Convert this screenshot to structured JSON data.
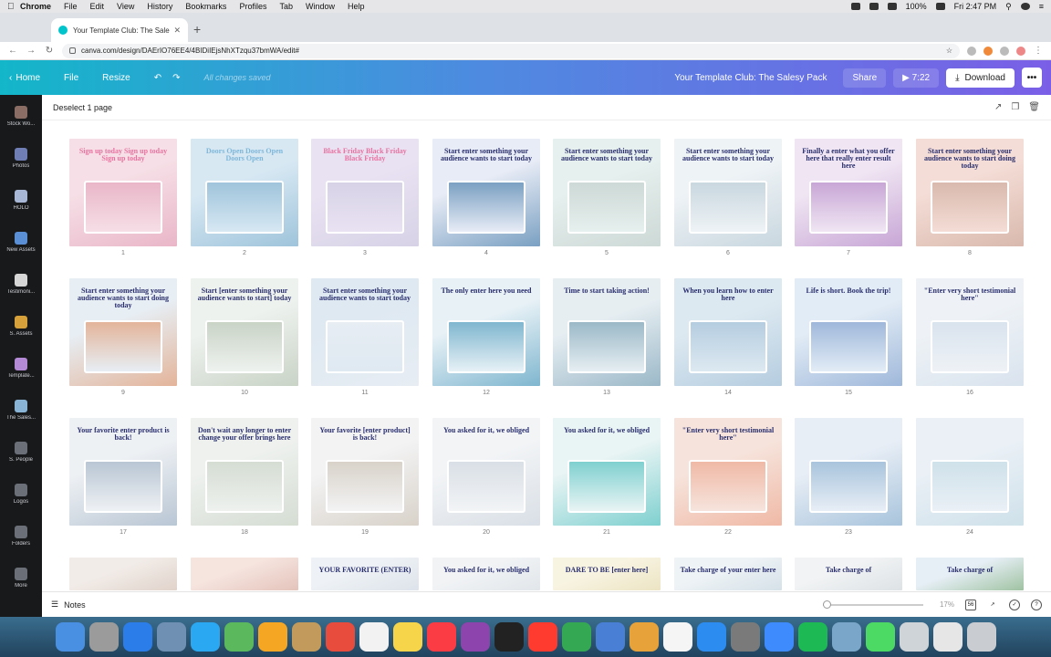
{
  "mac": {
    "app": "Chrome",
    "menus": [
      "File",
      "Edit",
      "View",
      "History",
      "Bookmarks",
      "Profiles",
      "Tab",
      "Window",
      "Help"
    ],
    "battery": "100%",
    "clock": "Fri 2:47 PM"
  },
  "browser": {
    "tab_title": "Your Template Club: The Sales",
    "url": "canva.com/design/DAErIO76EE4/4BIDiIEjsNhXTzqu37bmWA/edit#"
  },
  "canva": {
    "home": "Home",
    "file": "File",
    "resize": "Resize",
    "saved_status": "All changes saved",
    "design_title": "Your Template Club: The Salesy Pack",
    "share": "Share",
    "play_time": "7:22",
    "download": "Download",
    "more": "•••",
    "deselect": "Deselect 1 page",
    "notes": "Notes",
    "zoom": "17%",
    "grid_count": "56"
  },
  "sidebar": [
    {
      "label": "Stock Wo...",
      "color": "#8a6e66"
    },
    {
      "label": "Photos",
      "color": "#6f7fb5"
    },
    {
      "label": "HOLO",
      "color": "#a8b7d6"
    },
    {
      "label": "New Assets",
      "color": "#5a8fd6"
    },
    {
      "label": "Testimoni...",
      "color": "#d6d6d6"
    },
    {
      "label": "S. Assets",
      "color": "#d6a03a"
    },
    {
      "label": "Template...",
      "color": "#b48ad6"
    },
    {
      "label": "The Sales...",
      "color": "#8ab4d6"
    },
    {
      "label": "S. People",
      "color": "#6b6f78"
    },
    {
      "label": "Logos",
      "color": "#6b6f78"
    },
    {
      "label": "Folders",
      "color": "#6b6f78"
    },
    {
      "label": "More",
      "color": "#6b6f78"
    }
  ],
  "pages": [
    {
      "n": "1",
      "text": "Sign up today Sign up today Sign up today",
      "bg": "#f6dfe6",
      "bg2": "#e9b6c8",
      "ink": "#e873a0"
    },
    {
      "n": "2",
      "text": "Doors Open Doors Open Doors Open",
      "bg": "#d7e8f3",
      "bg2": "#9fc4db",
      "ink": "#7fb7d9"
    },
    {
      "n": "3",
      "text": "Black Friday Black Friday Black Friday",
      "bg": "#e9e2f3",
      "bg2": "#d7d2e6",
      "ink": "#e873a0"
    },
    {
      "n": "4",
      "text": "Start enter something your audience wants to start today",
      "bg": "#e8ecf6",
      "bg2": "#7aa0c2",
      "ink": "#2a2f6e"
    },
    {
      "n": "5",
      "text": "Start enter something your audience wants to start today",
      "bg": "#e6f0ee",
      "bg2": "#cdd9d6",
      "ink": "#2a2f6e"
    },
    {
      "n": "6",
      "text": "Start enter something your audience wants to start today",
      "bg": "#eef3f6",
      "bg2": "#c9d7df",
      "ink": "#2a2f6e"
    },
    {
      "n": "7",
      "text": "Finally a enter what you offer here that really enter result here",
      "bg": "#f0e6f3",
      "bg2": "#c8a6d6",
      "ink": "#2a2f6e"
    },
    {
      "n": "8",
      "text": "Start enter something your audience wants to start doing today",
      "bg": "#f4ddd6",
      "bg2": "#d9b9ad",
      "ink": "#2a2f6e"
    },
    {
      "n": "9",
      "text": "Start enter something your audience wants to start doing today",
      "bg": "#e7eef4",
      "bg2": "#e3b49a",
      "ink": "#2a2f6e"
    },
    {
      "n": "10",
      "text": "Start [enter something your audience wants to start] today",
      "bg": "#eef2ef",
      "bg2": "#c9d3c6",
      "ink": "#2a2f6e"
    },
    {
      "n": "11",
      "text": "Start enter something your audience wants to start today",
      "bg": "#dfe9f2",
      "bg2": "#e7edf3",
      "ink": "#2a2f6e"
    },
    {
      "n": "12",
      "text": "The only enter here you need",
      "bg": "#e7f1f6",
      "bg2": "#7fb6cf",
      "ink": "#2a2f6e"
    },
    {
      "n": "13",
      "text": "Time to start taking action!",
      "bg": "#e6eef2",
      "bg2": "#9bb8c8",
      "ink": "#2a2f6e"
    },
    {
      "n": "14",
      "text": "When you learn how to enter here",
      "bg": "#dde9f1",
      "bg2": "#b5cde0",
      "ink": "#2a2f6e"
    },
    {
      "n": "15",
      "text": "Life is short. Book the trip!",
      "bg": "#e2ecf6",
      "bg2": "#9fb8da",
      "ink": "#2a2f6e"
    },
    {
      "n": "16",
      "text": "\"Enter very short testimonial here\"",
      "bg": "#eef2f6",
      "bg2": "#d9e3ee",
      "ink": "#2a2f6e"
    },
    {
      "n": "17",
      "text": "Your favorite enter product is back!",
      "bg": "#eef1f4",
      "bg2": "#b9c6d4",
      "ink": "#2a2f6e"
    },
    {
      "n": "18",
      "text": "Don't wait any longer to enter change your offer brings here",
      "bg": "#eef1ee",
      "bg2": "#d5ddd3",
      "ink": "#2a2f6e"
    },
    {
      "n": "19",
      "text": "Your favorite [enter product] is back!",
      "bg": "#f3f3f4",
      "bg2": "#d8d2c9",
      "ink": "#2a2f6e"
    },
    {
      "n": "20",
      "text": "You asked for it, we obliged",
      "bg": "#f2f4f6",
      "bg2": "#d9dfe6",
      "ink": "#2a2f6e"
    },
    {
      "n": "21",
      "text": "You asked for it, we obliged",
      "bg": "#e9f4f4",
      "bg2": "#7fd0d0",
      "ink": "#2a2f6e"
    },
    {
      "n": "22",
      "text": "\"Enter very short testimonial here\"",
      "bg": "#f6e4dc",
      "bg2": "#f0b9a6",
      "ink": "#2a2f6e"
    },
    {
      "n": "23",
      "text": "",
      "bg": "#e8eef6",
      "bg2": "#a8c4dc",
      "ink": "#2a2f6e"
    },
    {
      "n": "24",
      "text": "",
      "bg": "#eaf0f6",
      "bg2": "#cfe1ea",
      "ink": "#2a2f6e"
    },
    {
      "n": "",
      "text": "",
      "bg": "#f2ece8",
      "bg2": "#e0d3cb",
      "ink": "#2a2f6e"
    },
    {
      "n": "",
      "text": "",
      "bg": "#f6e4df",
      "bg2": "#e4c4bb",
      "ink": "#2a2f6e"
    },
    {
      "n": "",
      "text": "YOUR FAVORITE (ENTER)",
      "bg": "#eef2f6",
      "bg2": "#dde3ea",
      "ink": "#2a2f6e"
    },
    {
      "n": "",
      "text": "You asked for it, we obliged",
      "bg": "#f1f3f5",
      "bg2": "#e1e6ea",
      "ink": "#2a2f6e"
    },
    {
      "n": "",
      "text": "DARE TO BE [enter here]",
      "bg": "#f8f4e2",
      "bg2": "#ece4c3",
      "ink": "#2a2f6e"
    },
    {
      "n": "",
      "text": "Take charge of your enter here",
      "bg": "#eef3f6",
      "bg2": "#d5e1e8",
      "ink": "#2a2f6e"
    },
    {
      "n": "",
      "text": "Take charge of",
      "bg": "#f1f3f4",
      "bg2": "#dde2e5",
      "ink": "#2a2f6e"
    },
    {
      "n": "",
      "text": "Take charge of",
      "bg": "#e7eff6",
      "bg2": "#9fc2a2",
      "ink": "#2a2f6e"
    }
  ],
  "dock": [
    "#4a90e2",
    "#9b9b9b",
    "#2b7de9",
    "#6f8fb3",
    "#2aa8f2",
    "#5cb85c",
    "#f5a623",
    "#c29a5b",
    "#e84c3d",
    "#f2f2f2",
    "#f7d54a",
    "#fc3c44",
    "#8e44ad",
    "#222222",
    "#ff3b30",
    "#34a853",
    "#4a7fd6",
    "#e8a23a",
    "#f5f5f5",
    "#2d8cf0",
    "#7a7a7a",
    "#3d8bfd",
    "#1db954",
    "#7aa6c9",
    "#4cd964",
    "#cfd4d8",
    "#e6e6e6",
    "#c9ccd0"
  ]
}
